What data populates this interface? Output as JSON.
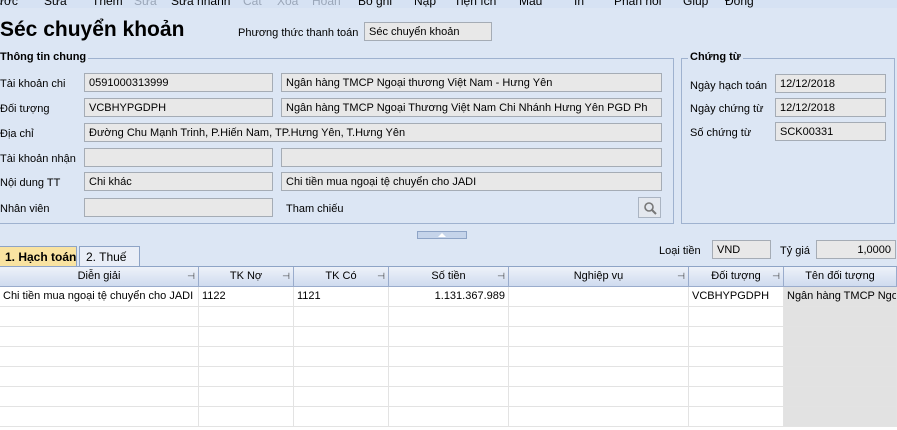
{
  "toolbar": {
    "items": [
      {
        "label": "ước",
        "disabled": false
      },
      {
        "label": "Sửa",
        "disabled": false
      },
      {
        "label": "Thêm",
        "disabled": false
      },
      {
        "label": "Sửa",
        "disabled": true
      },
      {
        "label": "Sửa nhanh",
        "disabled": false
      },
      {
        "label": "Cất",
        "disabled": true
      },
      {
        "label": "Xóa",
        "disabled": true
      },
      {
        "label": "Hoãn",
        "disabled": true
      },
      {
        "label": "Bỏ ghi",
        "disabled": false
      },
      {
        "label": "Nạp",
        "disabled": false
      },
      {
        "label": "Tiện ích",
        "disabled": false
      },
      {
        "label": "Mẫu",
        "disabled": false
      },
      {
        "label": "In",
        "disabled": false
      },
      {
        "label": "Phản hồi",
        "disabled": false
      },
      {
        "label": "Giúp",
        "disabled": false
      },
      {
        "label": "Đóng",
        "disabled": false
      }
    ]
  },
  "header": {
    "title": "Séc chuyển khoản",
    "payment_method_label": "Phương thức thanh toán",
    "payment_method_value": "Séc chuyển khoản"
  },
  "general": {
    "group_title": "Thông tin chung",
    "account_out_label": "Tài khoản chi",
    "account_out_value": "0591000313999",
    "account_out_bank": "Ngân hàng TMCP Ngoại thương Việt Nam - Hưng Yên",
    "object_label": "Đối tượng",
    "object_value": "VCBHYPGDPH",
    "object_name": "Ngân hàng TMCP Ngoại Thương Việt Nam Chi Nhánh Hưng Yên PGD Ph",
    "address_label": "Địa chỉ",
    "address_value": "Đường Chu Mạnh Trinh, P.Hiến Nam, TP.Hưng Yên, T.Hưng Yên",
    "account_in_label": "Tài khoản nhận",
    "account_in_value": "",
    "account_in_bank": "",
    "content_label": "Nội dung TT",
    "content_value": "Chi khác",
    "content_text": "Chi tiền mua ngoại tệ chuyển cho JADI",
    "staff_label": "Nhân viên",
    "staff_value": "",
    "reference_label": "Tham chiếu",
    "reference_icon": "search-icon"
  },
  "voucher": {
    "group_title": "Chứng từ",
    "posting_date_label": "Ngày hạch toán",
    "posting_date_value": "12/12/2018",
    "voucher_date_label": "Ngày chứng từ",
    "voucher_date_value": "12/12/2018",
    "voucher_no_label": "Số chứng từ",
    "voucher_no_value": "SCK00331"
  },
  "tabs": [
    {
      "label": "1. Hạch toán",
      "active": true
    },
    {
      "label": "2. Thuế",
      "active": false
    }
  ],
  "currency": {
    "label": "Loại tiền",
    "value": "VND",
    "rate_label": "Tỷ giá",
    "rate_value": "1,0000"
  },
  "grid": {
    "columns": [
      "Diễn giải",
      "TK Nợ",
      "TK Có",
      "Số tiền",
      "Nghiệp vụ",
      "Đối tượng",
      "Tên đối tượng"
    ],
    "rows": [
      [
        "Chi tiền mua ngoại tệ chuyển cho JADI",
        "1122",
        "1121",
        "1.131.367.989",
        "",
        "VCBHYPGDPH",
        "Ngân hàng TMCP Ngoại"
      ]
    ]
  }
}
